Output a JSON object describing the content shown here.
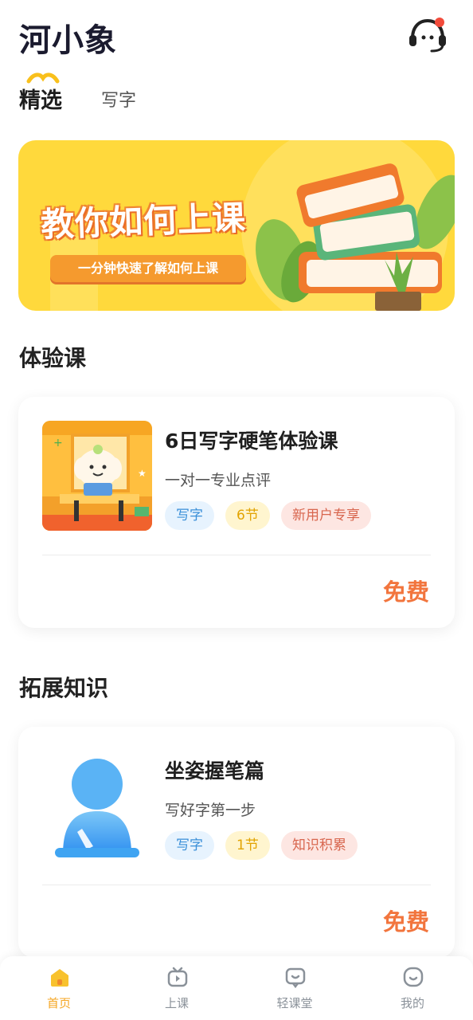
{
  "header": {
    "app_title": "河小象"
  },
  "tabs": [
    {
      "label": "精选",
      "active": true
    },
    {
      "label": "写字",
      "active": false
    }
  ],
  "banner": {
    "title": "教你如何上课",
    "subtitle": "一分钟快速了解如何上课"
  },
  "sections": {
    "trial": {
      "title": "体验课",
      "course": {
        "name": "6日写字硬笔体验课",
        "desc": "一对一专业点评",
        "tags": [
          "写字",
          "6节",
          "新用户专享"
        ],
        "price": "免费"
      }
    },
    "knowledge": {
      "title": "拓展知识",
      "course": {
        "name": "坐姿握笔篇",
        "desc": "写好字第一步",
        "tags": [
          "写字",
          "1节",
          "知识积累"
        ],
        "price": "免费"
      }
    }
  },
  "bottom_nav": [
    {
      "label": "首页",
      "icon": "home-icon",
      "active": true
    },
    {
      "label": "上课",
      "icon": "tv-icon",
      "active": false
    },
    {
      "label": "轻课堂",
      "icon": "chat-tv-icon",
      "active": false
    },
    {
      "label": "我的",
      "icon": "profile-icon",
      "active": false
    }
  ],
  "colors": {
    "accent": "#f5a623",
    "price": "#f2753d",
    "banner_bg": "#ffd93c"
  }
}
